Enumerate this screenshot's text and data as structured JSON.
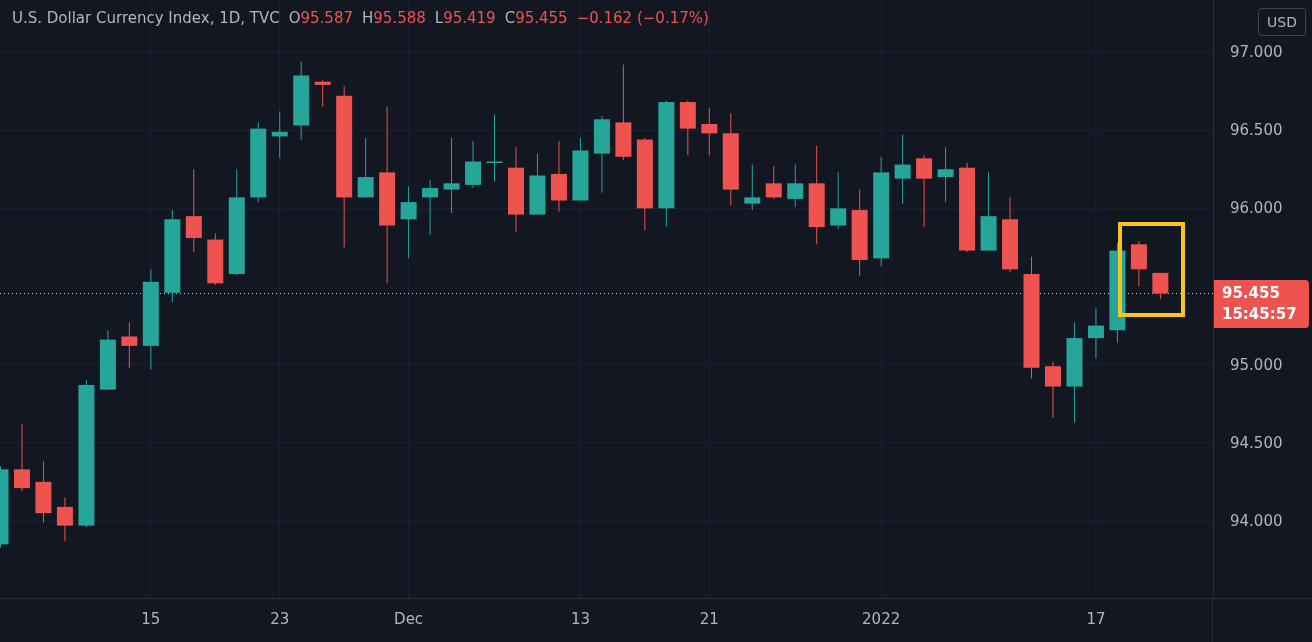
{
  "header": {
    "title": "U.S. Dollar Currency Index, 1D, TVC",
    "readings": [
      {
        "label": "O",
        "value": "95.587"
      },
      {
        "label": "H",
        "value": "95.588"
      },
      {
        "label": "L",
        "value": "95.419"
      },
      {
        "label": "C",
        "value": "95.455"
      }
    ],
    "change": "−0.162 (−0.17%)"
  },
  "currency_button": "USD",
  "last_price": {
    "price": "95.455",
    "countdown": "15:45:57"
  },
  "chart_data": {
    "type": "candlestick",
    "yticks": [
      {
        "value": 97,
        "label": "97.000"
      },
      {
        "value": 96.5,
        "label": "96.500"
      },
      {
        "value": 96,
        "label": "96.000"
      },
      {
        "value": 95,
        "label": "95.000"
      },
      {
        "value": 94.5,
        "label": "94.500"
      },
      {
        "value": 94,
        "label": "94.000"
      }
    ],
    "ylim": [
      93.507,
      97.333
    ],
    "grid": true,
    "ref_lines": [
      {
        "axis": "y",
        "value": 95.455
      }
    ],
    "categories": [
      null,
      null,
      null,
      null,
      null,
      null,
      null,
      "15",
      null,
      null,
      null,
      null,
      null,
      "23",
      null,
      null,
      null,
      null,
      null,
      "Dec",
      null,
      null,
      null,
      null,
      null,
      null,
      null,
      "13",
      null,
      null,
      null,
      null,
      null,
      "21",
      null,
      null,
      null,
      null,
      null,
      null,
      null,
      "2022",
      null,
      null,
      null,
      null,
      null,
      null,
      null,
      null,
      null,
      "17",
      null,
      null,
      null
    ],
    "ohlc": [
      [
        93.85,
        94.35,
        93.83,
        94.33
      ],
      [
        94.33,
        94.62,
        94.19,
        94.21
      ],
      [
        94.25,
        94.38,
        93.99,
        94.05
      ],
      [
        94.09,
        94.15,
        93.87,
        93.97
      ],
      [
        93.97,
        94.9,
        93.96,
        94.87
      ],
      [
        94.84,
        95.22,
        94.84,
        95.16
      ],
      [
        95.18,
        95.27,
        94.98,
        95.12
      ],
      [
        95.12,
        95.61,
        94.97,
        95.53
      ],
      [
        95.46,
        95.99,
        95.4,
        95.93
      ],
      [
        95.95,
        96.25,
        95.72,
        95.81
      ],
      [
        95.8,
        95.84,
        95.51,
        95.52
      ],
      [
        95.58,
        96.25,
        95.57,
        96.07
      ],
      [
        96.07,
        96.55,
        96.04,
        96.51
      ],
      [
        96.46,
        96.62,
        96.32,
        96.49
      ],
      [
        96.53,
        96.94,
        96.44,
        96.85
      ],
      [
        96.81,
        96.82,
        96.65,
        96.79
      ],
      [
        96.72,
        96.78,
        95.75,
        96.07
      ],
      [
        96.07,
        96.45,
        96.07,
        96.2
      ],
      [
        96.23,
        96.65,
        95.52,
        95.89
      ],
      [
        95.93,
        96.14,
        95.68,
        96.04
      ],
      [
        96.07,
        96.18,
        95.83,
        96.13
      ],
      [
        96.12,
        96.45,
        95.97,
        96.16
      ],
      [
        96.15,
        96.43,
        96.13,
        96.3
      ],
      [
        96.3,
        96.6,
        96.17,
        96.3
      ],
      [
        96.26,
        96.39,
        95.85,
        95.96
      ],
      [
        95.96,
        96.35,
        95.96,
        96.21
      ],
      [
        96.22,
        96.43,
        95.98,
        96.05
      ],
      [
        96.05,
        96.45,
        96.05,
        96.37
      ],
      [
        96.35,
        96.59,
        96.1,
        96.57
      ],
      [
        96.55,
        96.92,
        96.31,
        96.33
      ],
      [
        96.44,
        96.45,
        95.86,
        96.0
      ],
      [
        96.0,
        96.69,
        95.88,
        96.68
      ],
      [
        96.68,
        96.69,
        96.34,
        96.51
      ],
      [
        96.54,
        96.64,
        96.34,
        96.48
      ],
      [
        96.48,
        96.61,
        96.02,
        96.12
      ],
      [
        96.03,
        96.28,
        95.99,
        96.07
      ],
      [
        96.16,
        96.27,
        96.06,
        96.07
      ],
      [
        96.06,
        96.28,
        96.01,
        96.16
      ],
      [
        96.16,
        96.4,
        95.77,
        95.88
      ],
      [
        95.89,
        96.23,
        95.87,
        96.0
      ],
      [
        95.99,
        96.12,
        95.57,
        95.67
      ],
      [
        95.68,
        96.33,
        95.63,
        96.23
      ],
      [
        96.19,
        96.47,
        96.03,
        96.28
      ],
      [
        96.32,
        96.34,
        95.88,
        96.19
      ],
      [
        96.2,
        96.39,
        96.04,
        96.25
      ],
      [
        96.26,
        96.29,
        95.72,
        95.73
      ],
      [
        95.73,
        96.23,
        95.73,
        95.95
      ],
      [
        95.93,
        96.07,
        95.59,
        95.61
      ],
      [
        95.58,
        95.69,
        94.91,
        94.98
      ],
      [
        94.99,
        95.02,
        94.66,
        94.86
      ],
      [
        94.86,
        95.27,
        94.63,
        95.17
      ],
      [
        95.17,
        95.36,
        95.04,
        95.25
      ],
      [
        95.22,
        95.78,
        95.14,
        95.73
      ],
      [
        95.77,
        95.79,
        95.5,
        95.61
      ],
      [
        95.587,
        95.588,
        95.419,
        95.455
      ]
    ]
  }
}
